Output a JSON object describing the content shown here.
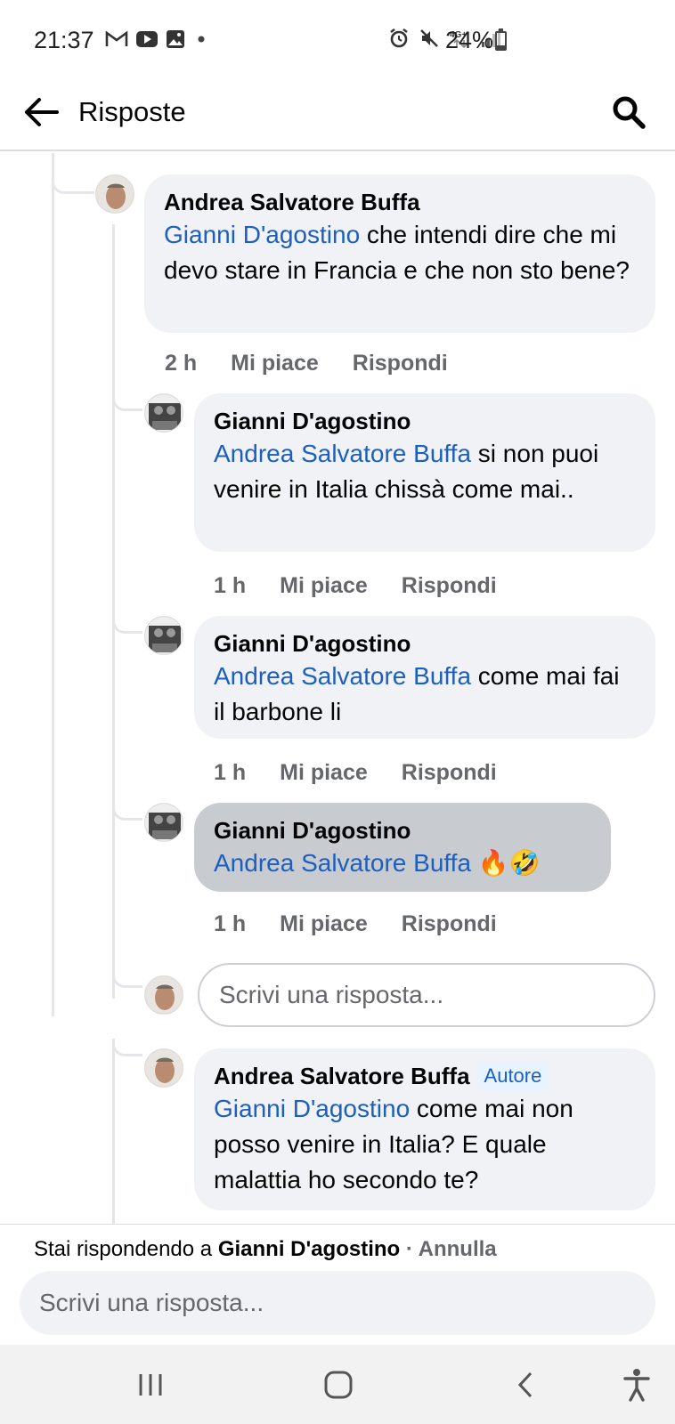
{
  "status_bar": {
    "time": "21:37",
    "battery": "24%",
    "battery_level": 0.24,
    "icons": [
      "gmail-icon",
      "youtube-icon",
      "gallery-icon",
      "dot-icon",
      "alarm-icon",
      "mute-icon",
      "4g-icon",
      "signal-icon",
      "battery-icon"
    ],
    "network": "4G+"
  },
  "header": {
    "title": "Risposte"
  },
  "comments": [
    {
      "author": "Andrea Salvatore Buffa",
      "mention": "Gianni D'agostino",
      "text": " che intendi dire che mi devo stare in Francia e che non sto bene?",
      "time": "2 h",
      "like": "Mi piace",
      "reply": "Rispondi"
    },
    {
      "author": "Gianni D'agostino",
      "mention": "Andrea Salvatore Buffa",
      "text": " si non puoi venire in Italia chissà come mai..",
      "time": "1 h",
      "like": "Mi piace",
      "reply": "Rispondi"
    },
    {
      "author": "Gianni D'agostino",
      "mention": "Andrea Salvatore Buffa",
      "text": " come mai fai il barbone li",
      "time": "1 h",
      "like": "Mi piace",
      "reply": "Rispondi"
    },
    {
      "author": "Gianni D'agostino",
      "mention": "Andrea Salvatore Buffa",
      "text": " 🔥🤣",
      "time": "1 h",
      "like": "Mi piace",
      "reply": "Rispondi"
    },
    {
      "author": "Andrea Salvatore Buffa",
      "badge": "Autore",
      "mention": "Gianni D'agostino",
      "text": " come mai non posso venire in Italia? E quale malattia ho secondo te?"
    }
  ],
  "inline_reply": {
    "placeholder": "Scrivi una risposta..."
  },
  "composer": {
    "replying_prefix": "Stai rispondendo a ",
    "replying_name": "Gianni D'agostino",
    "separator": " · ",
    "cancel": "Annulla",
    "placeholder": "Scrivi una risposta..."
  },
  "navbar": {
    "buttons": [
      "recents-icon",
      "home-icon",
      "back-icon",
      "accessibility-icon"
    ]
  }
}
